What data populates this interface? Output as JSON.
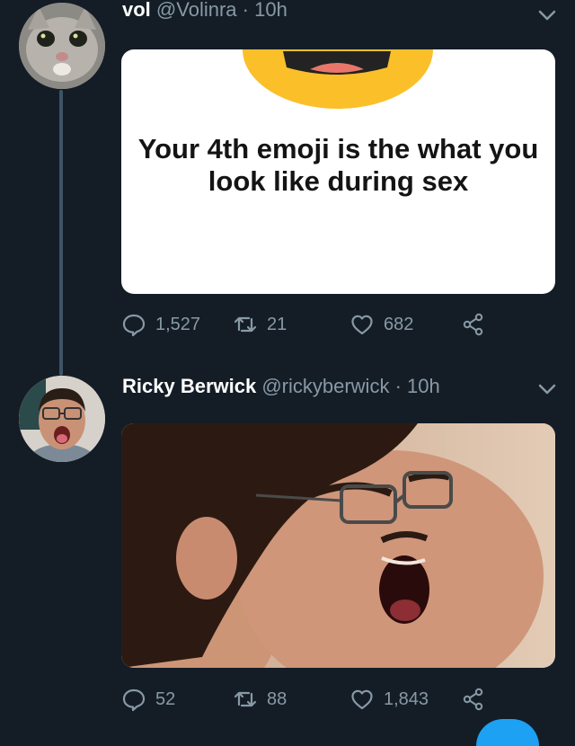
{
  "tweets": [
    {
      "name": "vol",
      "handle": "@Volinra",
      "separator": "·",
      "time": "10h",
      "avatar_icon": "cat-avatar-icon",
      "card_text": "Your 4th emoji is the what you look like during sex",
      "replies": "1,527",
      "retweets": "21",
      "likes": "682"
    },
    {
      "name": "Ricky Berwick",
      "handle": "@rickyberwick",
      "separator": "·",
      "time": "10h",
      "avatar_icon": "person-avatar-icon",
      "replies": "52",
      "retweets": "88",
      "likes": "1,843"
    }
  ],
  "colors": {
    "background": "#141d26",
    "secondary_text": "#8899a6",
    "thread_line": "#3d5466",
    "emoji_yellow": "#fbbf2a",
    "accent_blue": "#1da1f2"
  }
}
